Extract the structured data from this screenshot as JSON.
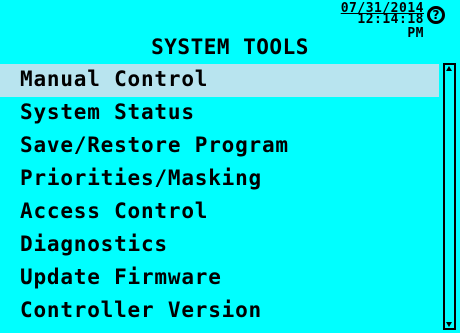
{
  "header": {
    "date": "07/31/2014",
    "time": "12:14:18 PM",
    "help_icon": "question-circle-icon",
    "help_label": "?"
  },
  "title": "SYSTEM TOOLS",
  "menu": {
    "selected_index": 0,
    "items": [
      {
        "label": "Manual Control"
      },
      {
        "label": "System Status"
      },
      {
        "label": "Save/Restore Program"
      },
      {
        "label": "Priorities/Masking"
      },
      {
        "label": "Access Control"
      },
      {
        "label": "Diagnostics"
      },
      {
        "label": "Update Firmware"
      },
      {
        "label": "Controller Version"
      }
    ]
  },
  "colors": {
    "background": "#00ffff",
    "selected_row": "#b8e4ef",
    "text": "#000000"
  }
}
